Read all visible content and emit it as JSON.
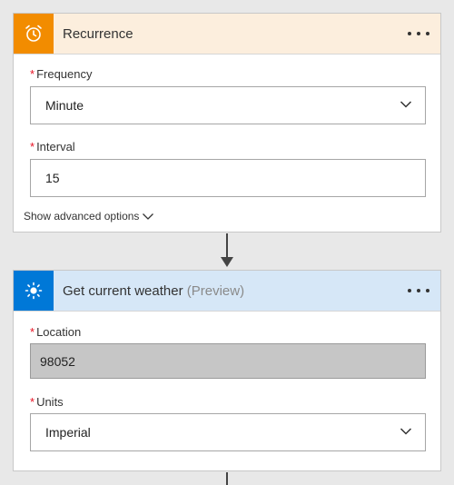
{
  "recurrence": {
    "title": "Recurrence",
    "header_color": "#fceedd",
    "icon_bg": "#f28c00",
    "icon": "alarm-clock-icon",
    "frequency": {
      "label": "Frequency",
      "required_mark": "*",
      "value": "Minute"
    },
    "interval": {
      "label": "Interval",
      "required_mark": "*",
      "value": "15"
    },
    "advanced_label": "Show advanced options"
  },
  "weather": {
    "title": "Get current weather",
    "title_suffix": "(Preview)",
    "header_color": "#d6e7f7",
    "icon_bg": "#0078d7",
    "icon": "sun-icon",
    "location": {
      "label": "Location",
      "required_mark": "*",
      "value": "98052"
    },
    "units": {
      "label": "Units",
      "required_mark": "*",
      "value": "Imperial"
    }
  }
}
